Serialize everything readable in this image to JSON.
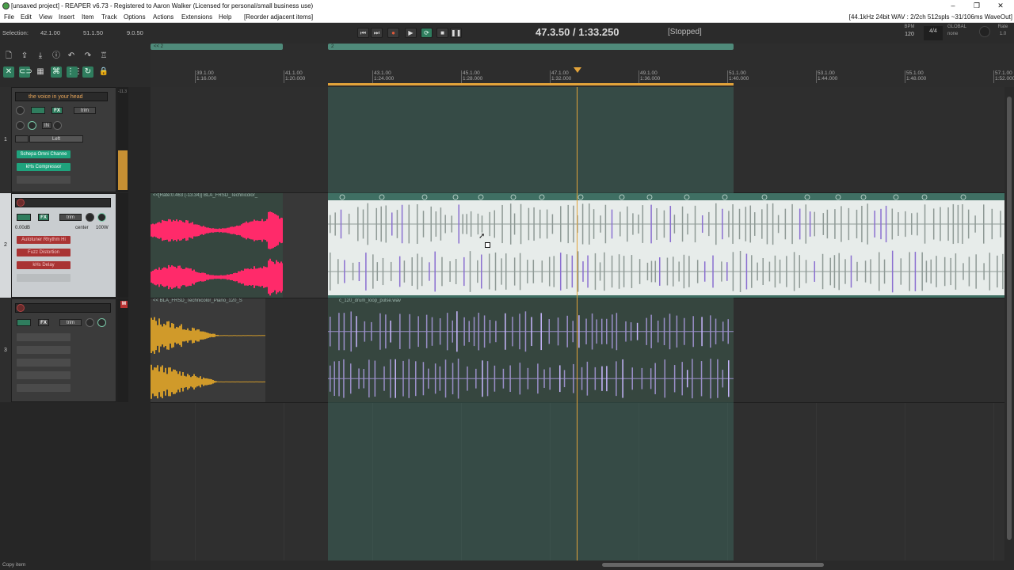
{
  "window": {
    "title": "[unsaved project] - REAPER v6.73 - Registered to Aaron Walker (Licensed for personal/small business use)",
    "controls": [
      "–",
      "❐",
      "✕"
    ]
  },
  "menu": {
    "items": [
      "File",
      "Edit",
      "View",
      "Insert",
      "Item",
      "Track",
      "Options",
      "Actions",
      "Extensions",
      "Help",
      "[Reorder adjacent items]"
    ],
    "audio_status": "[44.1kHz 24bit WAV : 2/2ch 512spls ~31/106ms WaveOut]"
  },
  "transport": {
    "selection_label": "Selection:",
    "selection_start": "42.1.00",
    "selection_end": "51.1.50",
    "selection_length": "9.0.50",
    "timecode": "47.3.50 / 1:33.250",
    "state": "[Stopped]",
    "bpm_label": "BPM",
    "bpm": "120",
    "time_sig": "4/4",
    "global_label": "GLOBAL",
    "global_value": "none",
    "rate_label": "Rate",
    "rate": "1.0"
  },
  "ruler": {
    "regions": [
      "<< 2",
      "2"
    ],
    "ticks": [
      {
        "bar": "39.1.00",
        "time": "1:16.000"
      },
      {
        "bar": "41.1.00",
        "time": "1:20.000"
      },
      {
        "bar": "43.1.00",
        "time": "1:24.000"
      },
      {
        "bar": "45.1.00",
        "time": "1:28.000"
      },
      {
        "bar": "47.1.00",
        "time": "1:32.000"
      },
      {
        "bar": "49.1.00",
        "time": "1:36.000"
      },
      {
        "bar": "51.1.00",
        "time": "1:40.000"
      },
      {
        "bar": "53.1.00",
        "time": "1:44.000"
      },
      {
        "bar": "55.1.00",
        "time": "1:48.000"
      },
      {
        "bar": "57.1.00",
        "time": "1:52.000"
      }
    ]
  },
  "tracks": [
    {
      "number": "1",
      "name": "the voice in your head",
      "meter_top": "-11.3",
      "route": "Left",
      "fx": [
        "Schepa Omni Channe",
        "kHs Compressor"
      ],
      "fx_label": "FX",
      "trim_label": "trim",
      "in_label": "IN"
    },
    {
      "number": "2",
      "name": "",
      "volume": "0.00dB",
      "pan": "center",
      "width": "100W",
      "fx": [
        "Autotuner Rhythm Hi",
        "Fuzz Distortion",
        "kHs Delay"
      ],
      "fx_label": "FX",
      "trim_label": "trim",
      "item_label": "<<[Rate:0.463 (-13.34)] BLA_FRSD_Technicolor_",
      "item_label_right": ""
    },
    {
      "number": "3",
      "name": "",
      "fx_label": "FX",
      "trim_label": "trim",
      "mute": "M",
      "item_label": "<< BLA_FRSD_Technicolor_Piano_120_S",
      "item_label_right": "c_120_drum_loop_pulse.wav"
    }
  ],
  "status_bar": "Copy item",
  "colors": {
    "accent": "#e2a33a",
    "fx_green": "#1fa37d",
    "fx_red": "#a93333",
    "time_selection": "#46826f",
    "waveform_pink": "#ff2a6a",
    "waveform_white": "#f0f0f0",
    "waveform_purple": "#8a6fd0",
    "waveform_gold": "#d09a2a"
  },
  "icons": [
    "new-project-icon",
    "open-icon",
    "save-icon",
    "settings-icon",
    "undo-icon",
    "redo-icon",
    "metronome-icon",
    "ripple-icon",
    "link-icon",
    "grid-icon",
    "snap-icon",
    "loop-icon",
    "lock-icon"
  ]
}
